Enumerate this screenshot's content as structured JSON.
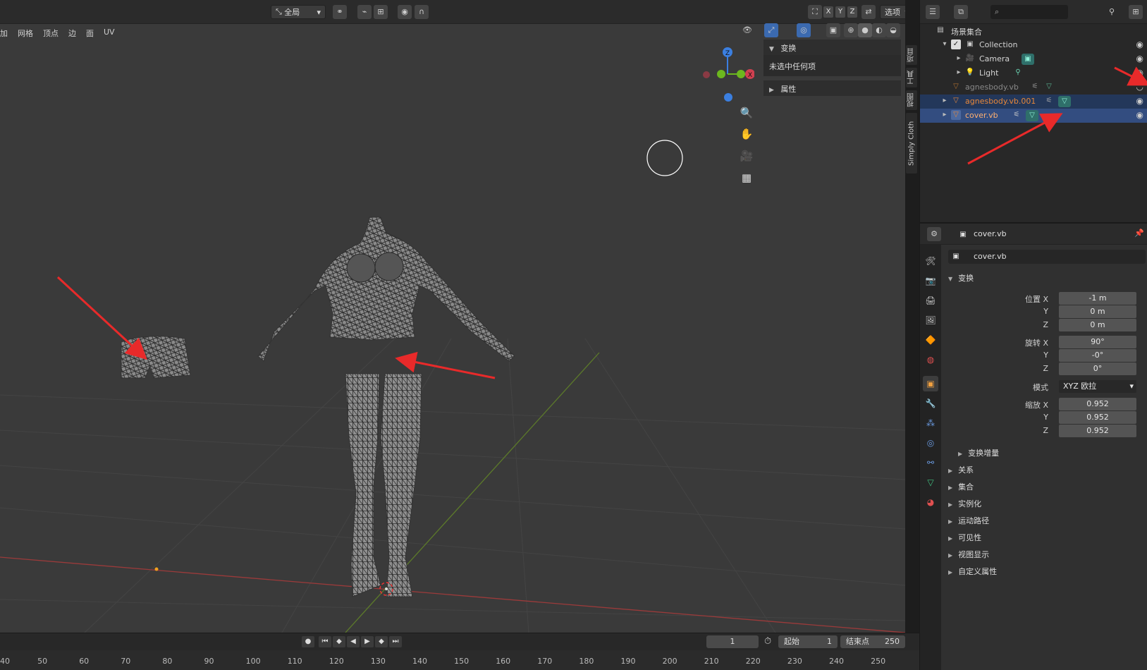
{
  "viewport": {
    "header": {
      "transform_orientation": "全局",
      "axis_x": "X",
      "axis_y": "Y",
      "axis_z": "Z",
      "options_label": "选项"
    },
    "menu": [
      "加",
      "网格",
      "顶点",
      "边",
      "面",
      "UV"
    ],
    "gizmo": {
      "z": "Z",
      "x": "X"
    },
    "npanel": {
      "transform_title": "变换",
      "nothing_selected": "未选中任何项",
      "properties_title": "属性"
    },
    "side_tabs": [
      "项目",
      "工具",
      "视图",
      "Simply Cloth"
    ]
  },
  "outliner": {
    "root": "场景集合",
    "items": [
      {
        "label": "Collection",
        "type": "collection"
      },
      {
        "label": "Camera",
        "type": "camera"
      },
      {
        "label": "Light",
        "type": "light"
      },
      {
        "label": "agnesbody.vb",
        "type": "mesh"
      },
      {
        "label": "agnesbody.vb.001",
        "type": "mesh"
      },
      {
        "label": "cover.vb",
        "type": "mesh"
      }
    ]
  },
  "properties": {
    "header_object": "cover.vb",
    "object_name": "cover.vb",
    "transform_title": "变换",
    "location_label": "位置 X",
    "rotation_label": "旋转 X",
    "scale_label": "缩放 X",
    "y_label": "Y",
    "z_label": "Z",
    "mode_label": "模式",
    "location": {
      "x": "-1 m",
      "y": "0 m",
      "z": "0 m"
    },
    "rotation": {
      "x": "90°",
      "y": "-0°",
      "z": "0°"
    },
    "rotation_mode": "XYZ 欧拉",
    "scale": {
      "x": "0.952",
      "y": "0.952",
      "z": "0.952"
    },
    "delta_transform": "变换增量",
    "sections": [
      "关系",
      "集合",
      "实例化",
      "运动路径",
      "可见性",
      "视图显示",
      "自定义属性"
    ]
  },
  "timeline": {
    "current_frame": "1",
    "start_label": "起始",
    "start_value": "1",
    "end_label": "结束点",
    "end_value": "250",
    "ticks": [
      "40",
      "50",
      "60",
      "70",
      "80",
      "90",
      "100",
      "110",
      "120",
      "130",
      "140",
      "150",
      "160",
      "170",
      "180",
      "190",
      "200",
      "210",
      "220",
      "230",
      "240",
      "250"
    ]
  },
  "colors": {
    "accent_selected": "#334d80",
    "annotation_arrow": "#e82a2a",
    "axis_x": "#d04050",
    "axis_y": "#6cb81e",
    "axis_z": "#3b7fe0",
    "object_orange": "#e8883a"
  }
}
